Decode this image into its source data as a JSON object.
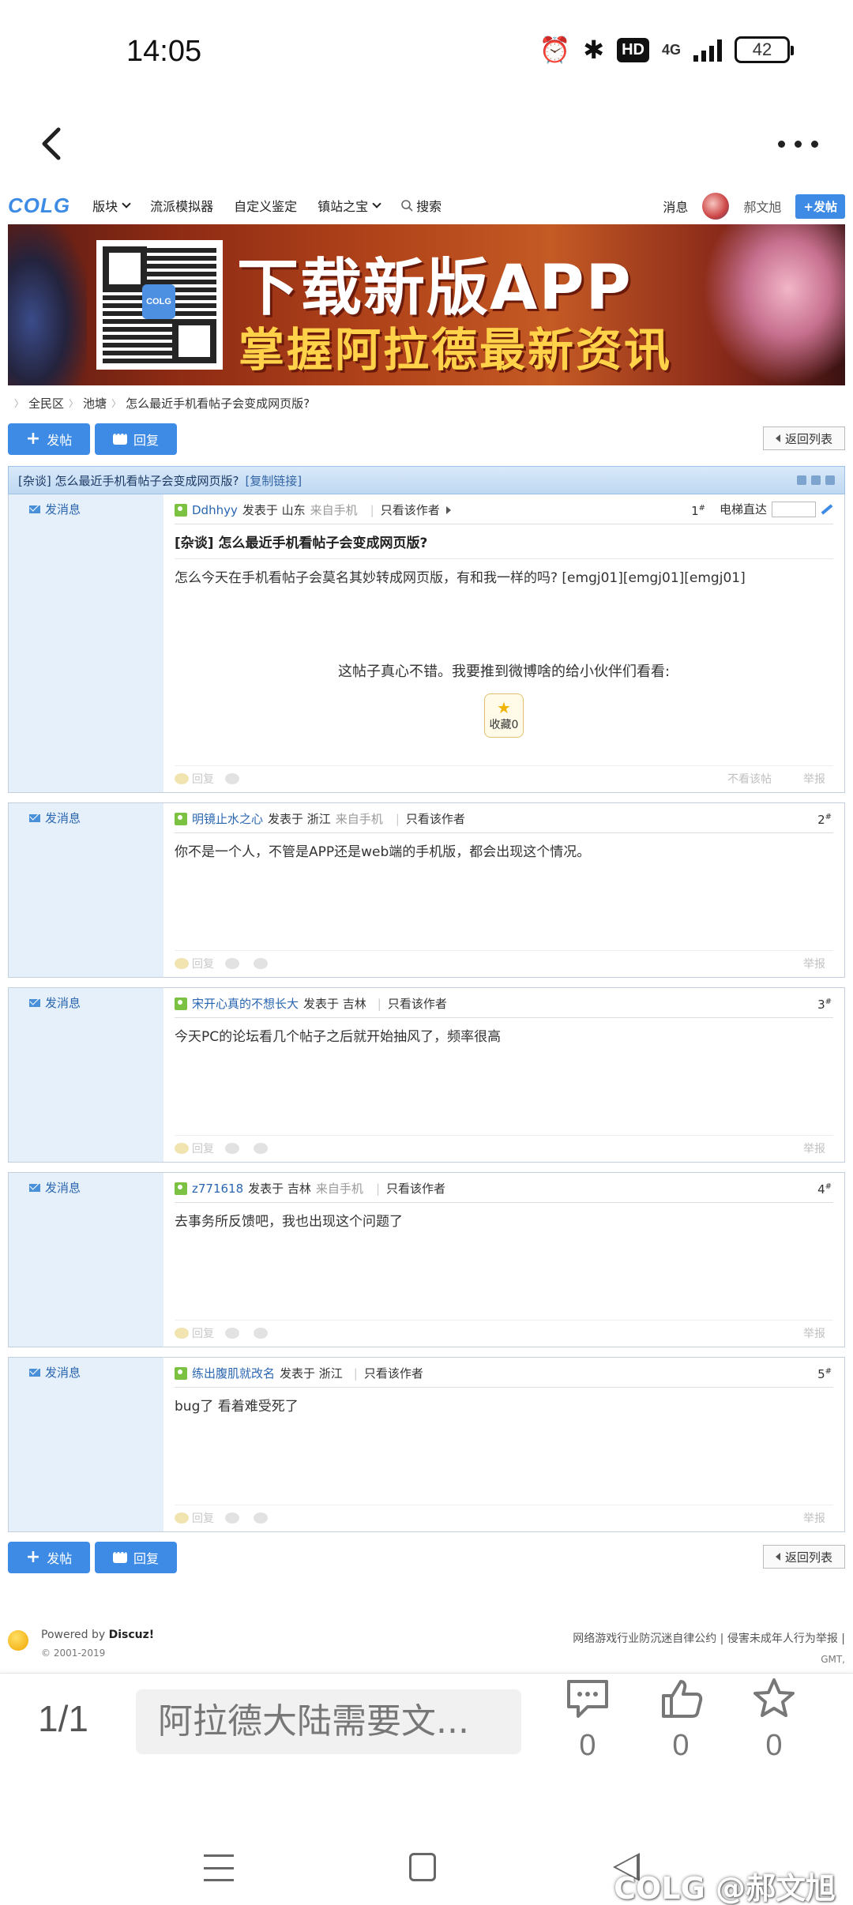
{
  "status_bar": {
    "time": "14:05",
    "network": "4G",
    "hd": "HD",
    "battery": "42"
  },
  "site": {
    "logo": "COLG",
    "nav": [
      {
        "label": "版块",
        "dropdown": true
      },
      {
        "label": "流派模拟器",
        "dropdown": false
      },
      {
        "label": "自定义鉴定",
        "dropdown": false
      },
      {
        "label": "镇站之宝",
        "dropdown": true
      },
      {
        "label": "搜索",
        "dropdown": false
      }
    ],
    "messages": "消息",
    "user": "郝文旭",
    "post_new": "+发帖",
    "brand_color": "#3d8be5"
  },
  "banner": {
    "title": "下载新版APP",
    "subtitle": "掌握阿拉德最新资讯",
    "qr_logo": "COLG"
  },
  "breadcrumb": [
    "全民区",
    "池塘",
    "怎么最近手机看帖子会变成网页版?"
  ],
  "actions": {
    "post": "发帖",
    "reply": "回复",
    "back_to_list": "返回列表"
  },
  "thread": {
    "header": "[杂谈] 怎么最近手机看帖子会变成网页版?",
    "copy_link": "[复制链接]",
    "jump_label": "电梯直达"
  },
  "posts": [
    {
      "send_msg": "发消息",
      "author": "Ddhhyy",
      "posted_in": "发表于 山东",
      "source": "来自手机",
      "only_author": "只看该作者",
      "floor": "1",
      "title": "[杂谈] 怎么最近手机看帖子会变成网页版?",
      "body": "怎么今天在手机看帖子会莫名其妙转成网页版，有和我一样的吗? [emgj01][emgj01][emgj01]",
      "share_text": "这帖子真心不错。我要推到微博啥的给小伙伴们看看:",
      "favorite": "收藏0",
      "reply": "回复",
      "dislike": "不看该帖",
      "report": "举报"
    },
    {
      "send_msg": "发消息",
      "author": "明镜止水之心",
      "posted_in": "发表于 浙江",
      "source": "来自手机",
      "only_author": "只看该作者",
      "floor": "2",
      "body": "你不是一个人，不管是APP还是web端的手机版，都会出现这个情况。",
      "reply": "回复",
      "report": "举报"
    },
    {
      "send_msg": "发消息",
      "author": "宋开心真的不想长大",
      "posted_in": "发表于 吉林",
      "source": "",
      "only_author": "只看该作者",
      "floor": "3",
      "body": "今天PC的论坛看几个帖子之后就开始抽风了，频率很高",
      "reply": "回复",
      "report": "举报"
    },
    {
      "send_msg": "发消息",
      "author": "z771618",
      "posted_in": "发表于 吉林",
      "source": "来自手机",
      "only_author": "只看该作者",
      "floor": "4",
      "body": "去事务所反馈吧，我也出现这个问题了",
      "reply": "回复",
      "report": "举报"
    },
    {
      "send_msg": "发消息",
      "author": "练出腹肌就改名",
      "posted_in": "发表于 浙江",
      "source": "",
      "only_author": "只看该作者",
      "floor": "5",
      "body": "bug了 看着难受死了",
      "reply": "回复",
      "report": "举报"
    }
  ],
  "footer": {
    "powered_prefix": "Powered by",
    "powered_brand": "Discuz!",
    "copyright": "© 2001-2019",
    "right_links": "网络游戏行业防沉迷自律公约 | 侵害未成年人行为举报 |",
    "gmt": "GMT,"
  },
  "app_bar": {
    "page_indicator": "1/1",
    "comment_placeholder": "阿拉德大陆需要文...",
    "comments": "0",
    "likes": "0",
    "favorites": "0"
  },
  "watermark": "COLG @郝文旭"
}
